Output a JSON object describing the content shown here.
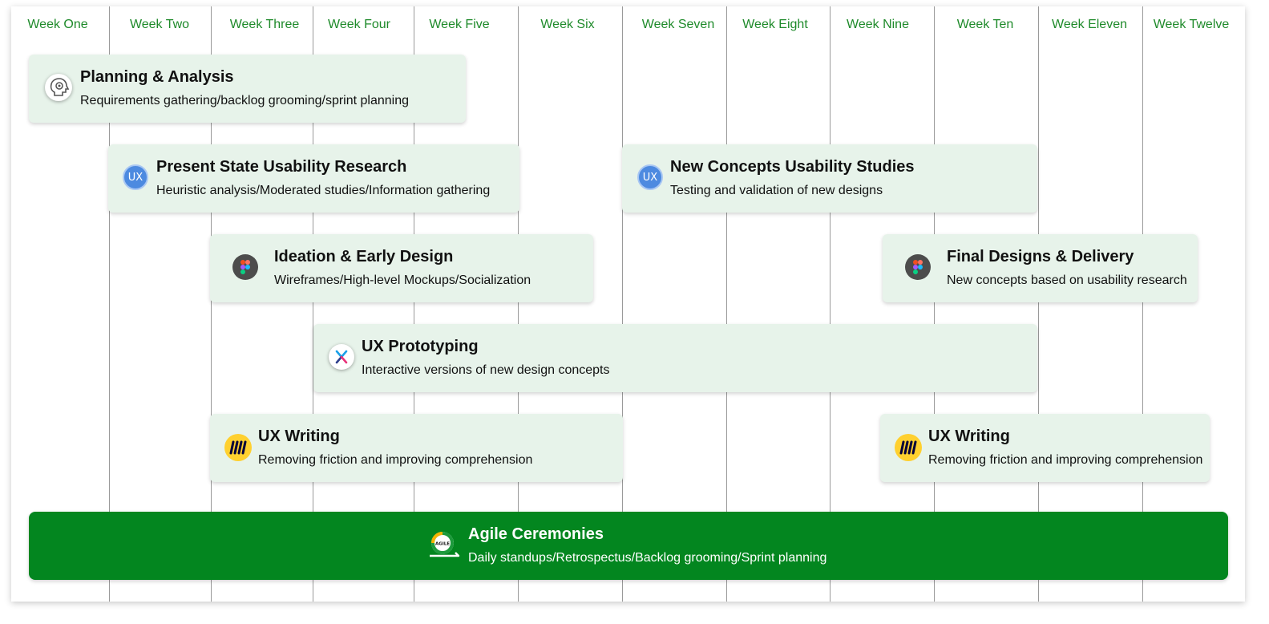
{
  "weeks": [
    "Week One",
    "Week Two",
    "Week Three",
    "Week Four",
    "Week Five",
    "Week Six",
    "Week Seven",
    "Week Eight",
    "Week Nine",
    "Week Ten",
    "Week Eleven",
    "Week Twelve"
  ],
  "tasks": {
    "planning": {
      "title": "Planning & Analysis",
      "subtitle": "Requirements gathering/backlog grooming/sprint planning",
      "icon": "head-gear-icon"
    },
    "research": {
      "title": "Present State Usability Research",
      "subtitle": "Heuristic analysis/Moderated studies/Information gathering",
      "icon": "ux-badge-icon",
      "icon_text": "UX"
    },
    "studies": {
      "title": "New Concepts Usability Studies",
      "subtitle": "Testing and validation of new designs",
      "icon": "ux-badge-icon",
      "icon_text": "UX"
    },
    "ideation": {
      "title": "Ideation & Early Design",
      "subtitle": "Wireframes/High-level Mockups/Socialization",
      "icon": "figma-icon"
    },
    "final": {
      "title": "Final Designs & Delivery",
      "subtitle": "New concepts based on usability research",
      "icon": "figma-icon"
    },
    "prototyping": {
      "title": "UX Prototyping",
      "subtitle": "Interactive versions of new design concepts",
      "icon": "prototype-x-icon"
    },
    "writing1": {
      "title": "UX Writing",
      "subtitle": "Removing friction and improving comprehension",
      "icon": "miro-icon"
    },
    "writing2": {
      "title": "UX Writing",
      "subtitle": "Removing friction and improving comprehension",
      "icon": "miro-icon"
    },
    "agile": {
      "title": "Agile Ceremonies",
      "subtitle": "Daily standups/Retrospectus/Backlog grooming/Sprint planning",
      "icon": "agile-loop-icon",
      "icon_text": "AGILE"
    }
  },
  "colors": {
    "week_label": "#1e8a2a",
    "card_bg": "#e7f3ea",
    "agile_bg": "#03861f",
    "ux_badge": "#4d8ae0",
    "miro_yellow": "#ffd02f"
  }
}
